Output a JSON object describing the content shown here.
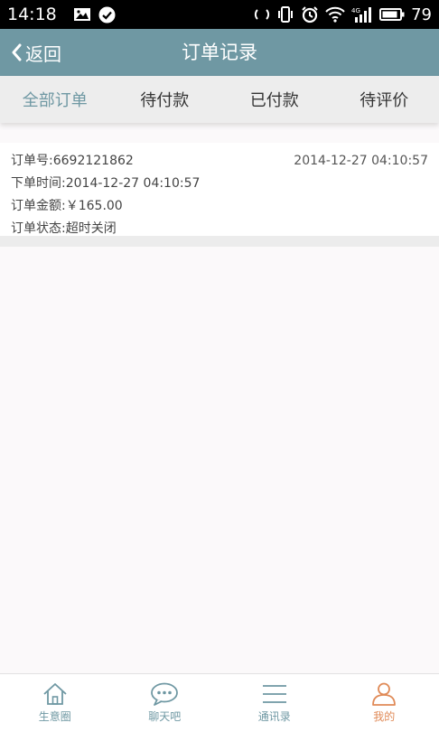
{
  "status_bar": {
    "time": "14:18",
    "battery": "79"
  },
  "header": {
    "back_label": "返回",
    "title": "订单记录"
  },
  "tabs": [
    {
      "label": "全部订单",
      "active": true
    },
    {
      "label": "待付款",
      "active": false
    },
    {
      "label": "已付款",
      "active": false
    },
    {
      "label": "待评价",
      "active": false
    }
  ],
  "order": {
    "number_label": "订单号: ",
    "number": "6692121862",
    "date": "2014-12-27 04:10:57",
    "time_label": "下单时间: ",
    "time": "2014-12-27 04:10:57",
    "amount_label": "订单金额: ",
    "amount": "￥165.00",
    "status_label": "订单状态: ",
    "status": "超时关闭"
  },
  "bottom_nav": [
    {
      "label": "生意圈",
      "icon": "home-icon"
    },
    {
      "label": "聊天吧",
      "icon": "chat-icon"
    },
    {
      "label": "通讯录",
      "icon": "list-icon"
    },
    {
      "label": "我的",
      "icon": "person-icon",
      "active": true
    }
  ],
  "colors": {
    "header": "#6f98a3",
    "accent": "#6f98a3",
    "active_nav": "#e08a57",
    "tab_bar": "#ededed"
  }
}
